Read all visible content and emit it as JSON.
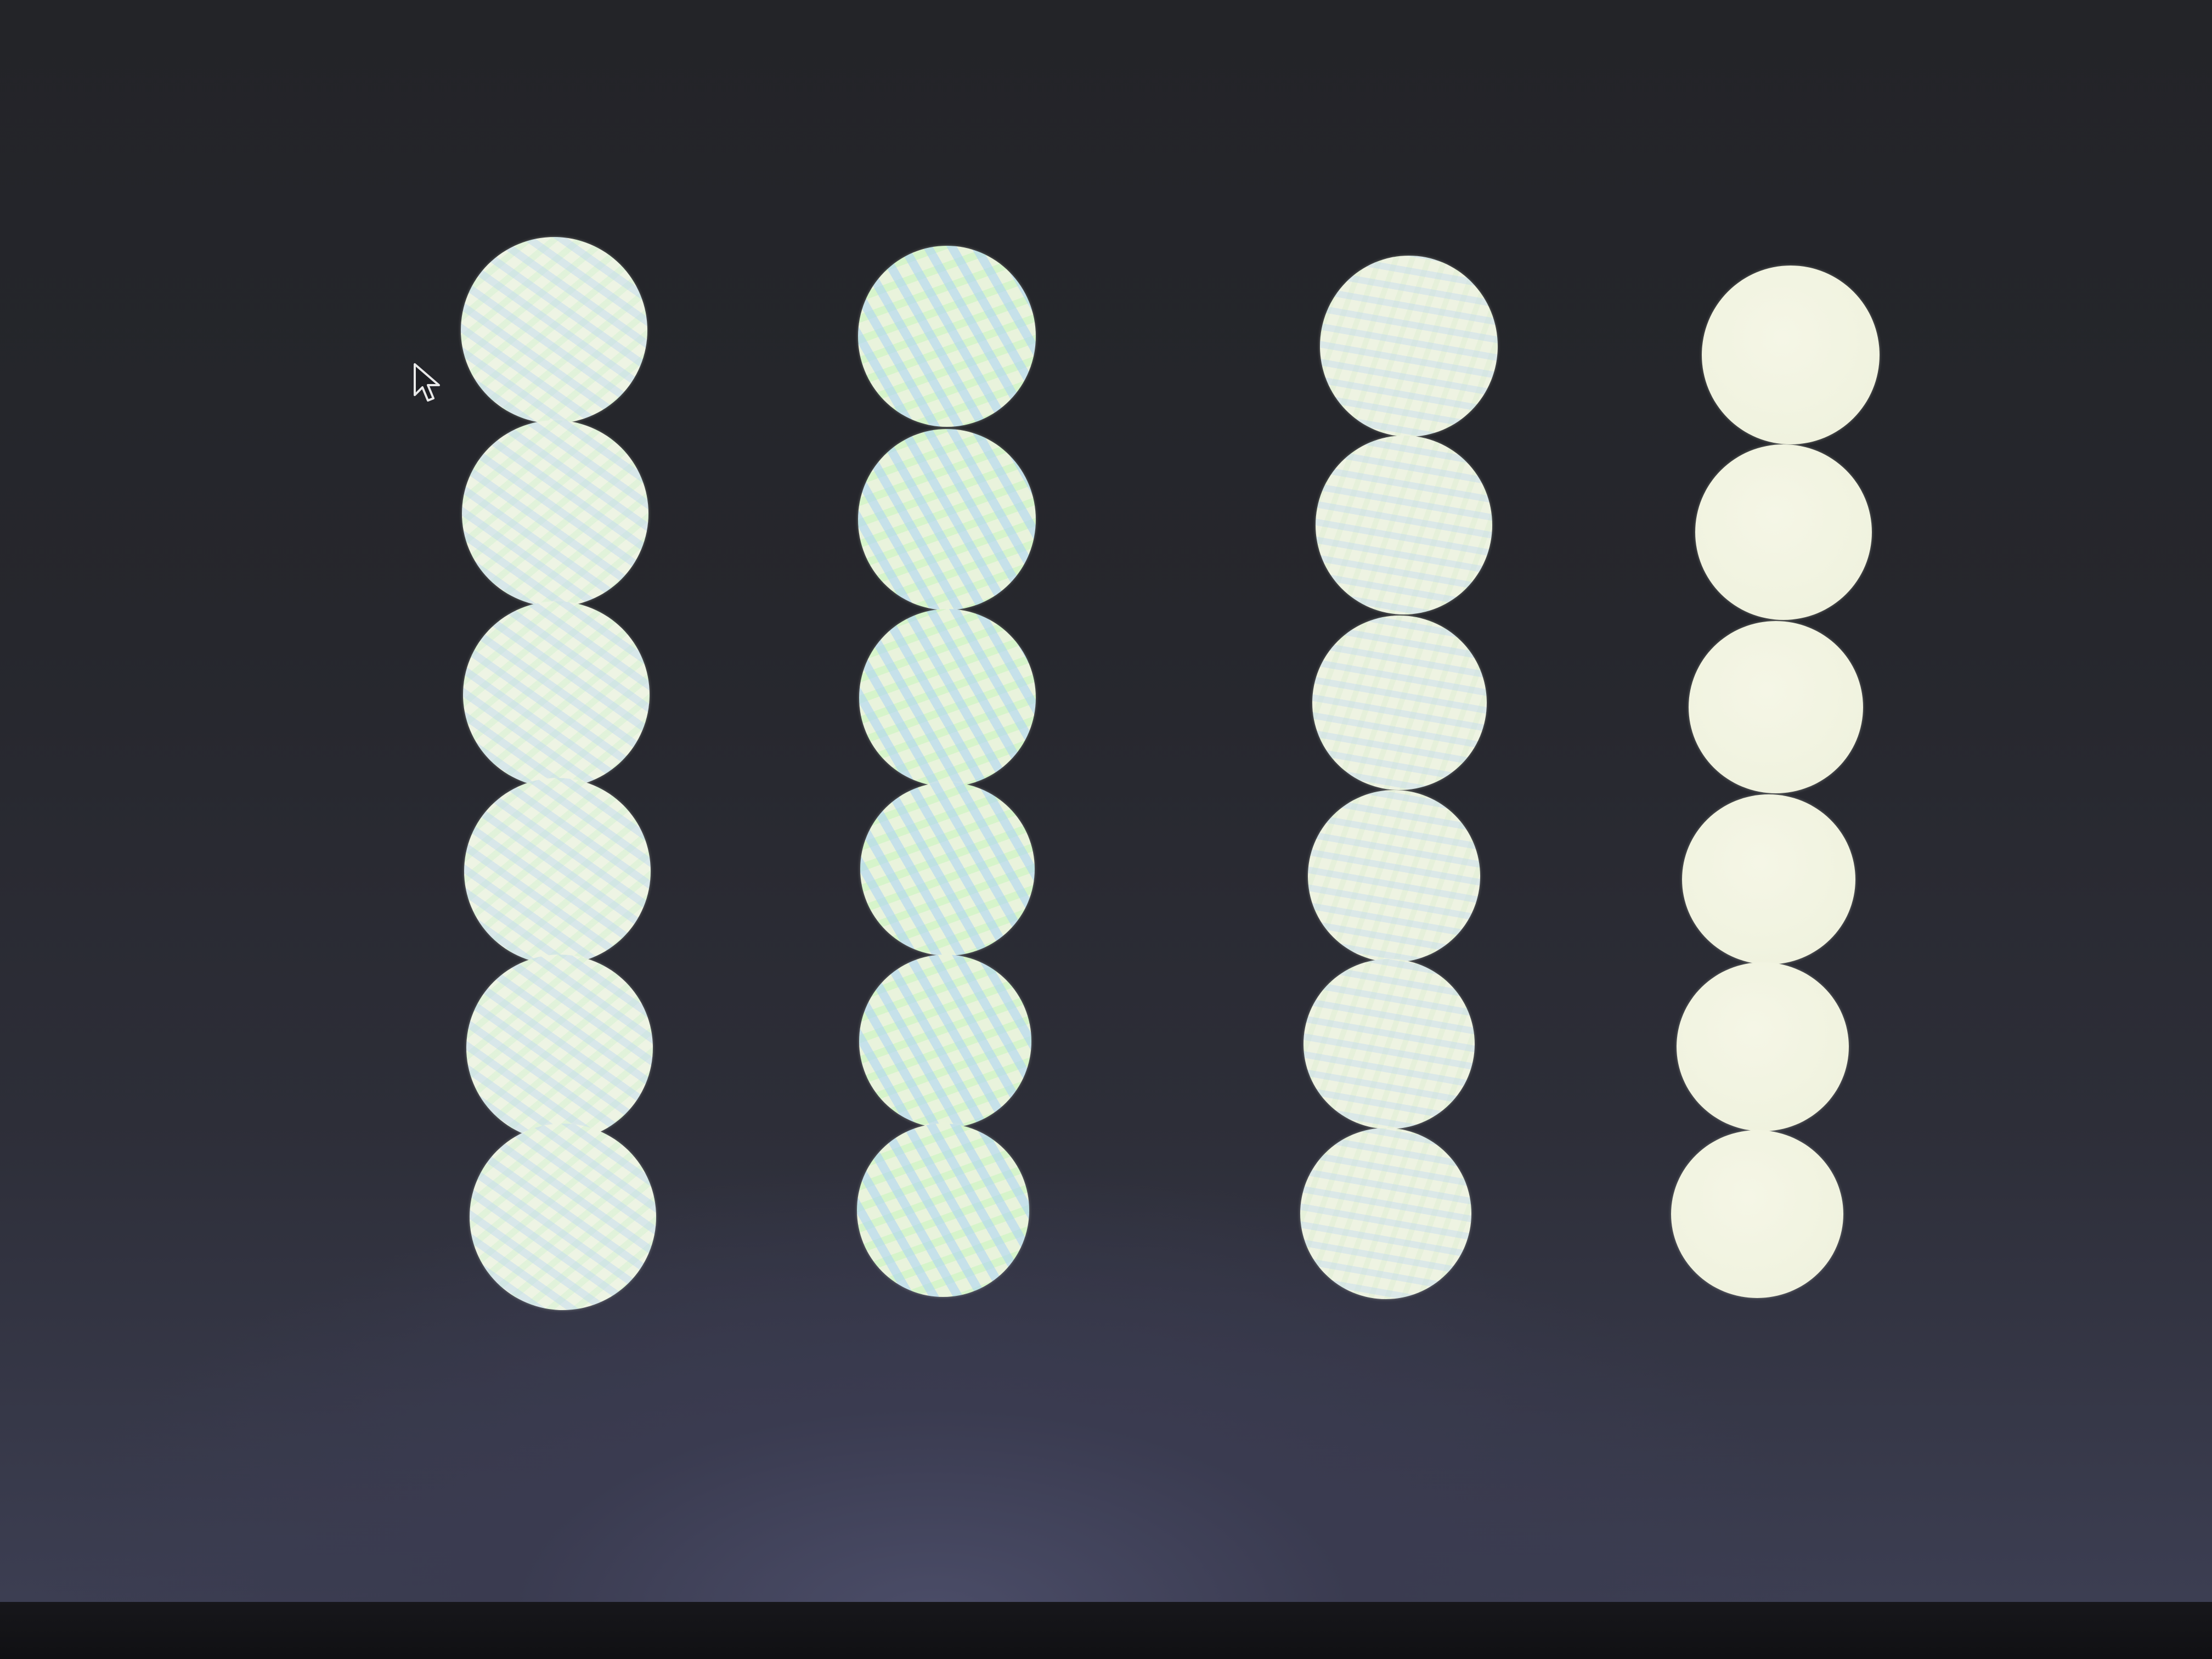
{
  "screen": {
    "background": "#26272d",
    "bezel_color": "#111114"
  },
  "cursor": {
    "icon": "arrow-pointer-icon"
  },
  "test_pattern": {
    "columns": [
      {
        "name": "column-1",
        "pattern": "moire-fine",
        "dot_count": 6
      },
      {
        "name": "column-2",
        "pattern": "moire-coarse",
        "dot_count": 6
      },
      {
        "name": "column-3",
        "pattern": "moire-medium",
        "dot_count": 6
      },
      {
        "name": "column-4",
        "pattern": "solid",
        "dot_count": 6
      }
    ],
    "dot_color": "#eef3e2"
  }
}
